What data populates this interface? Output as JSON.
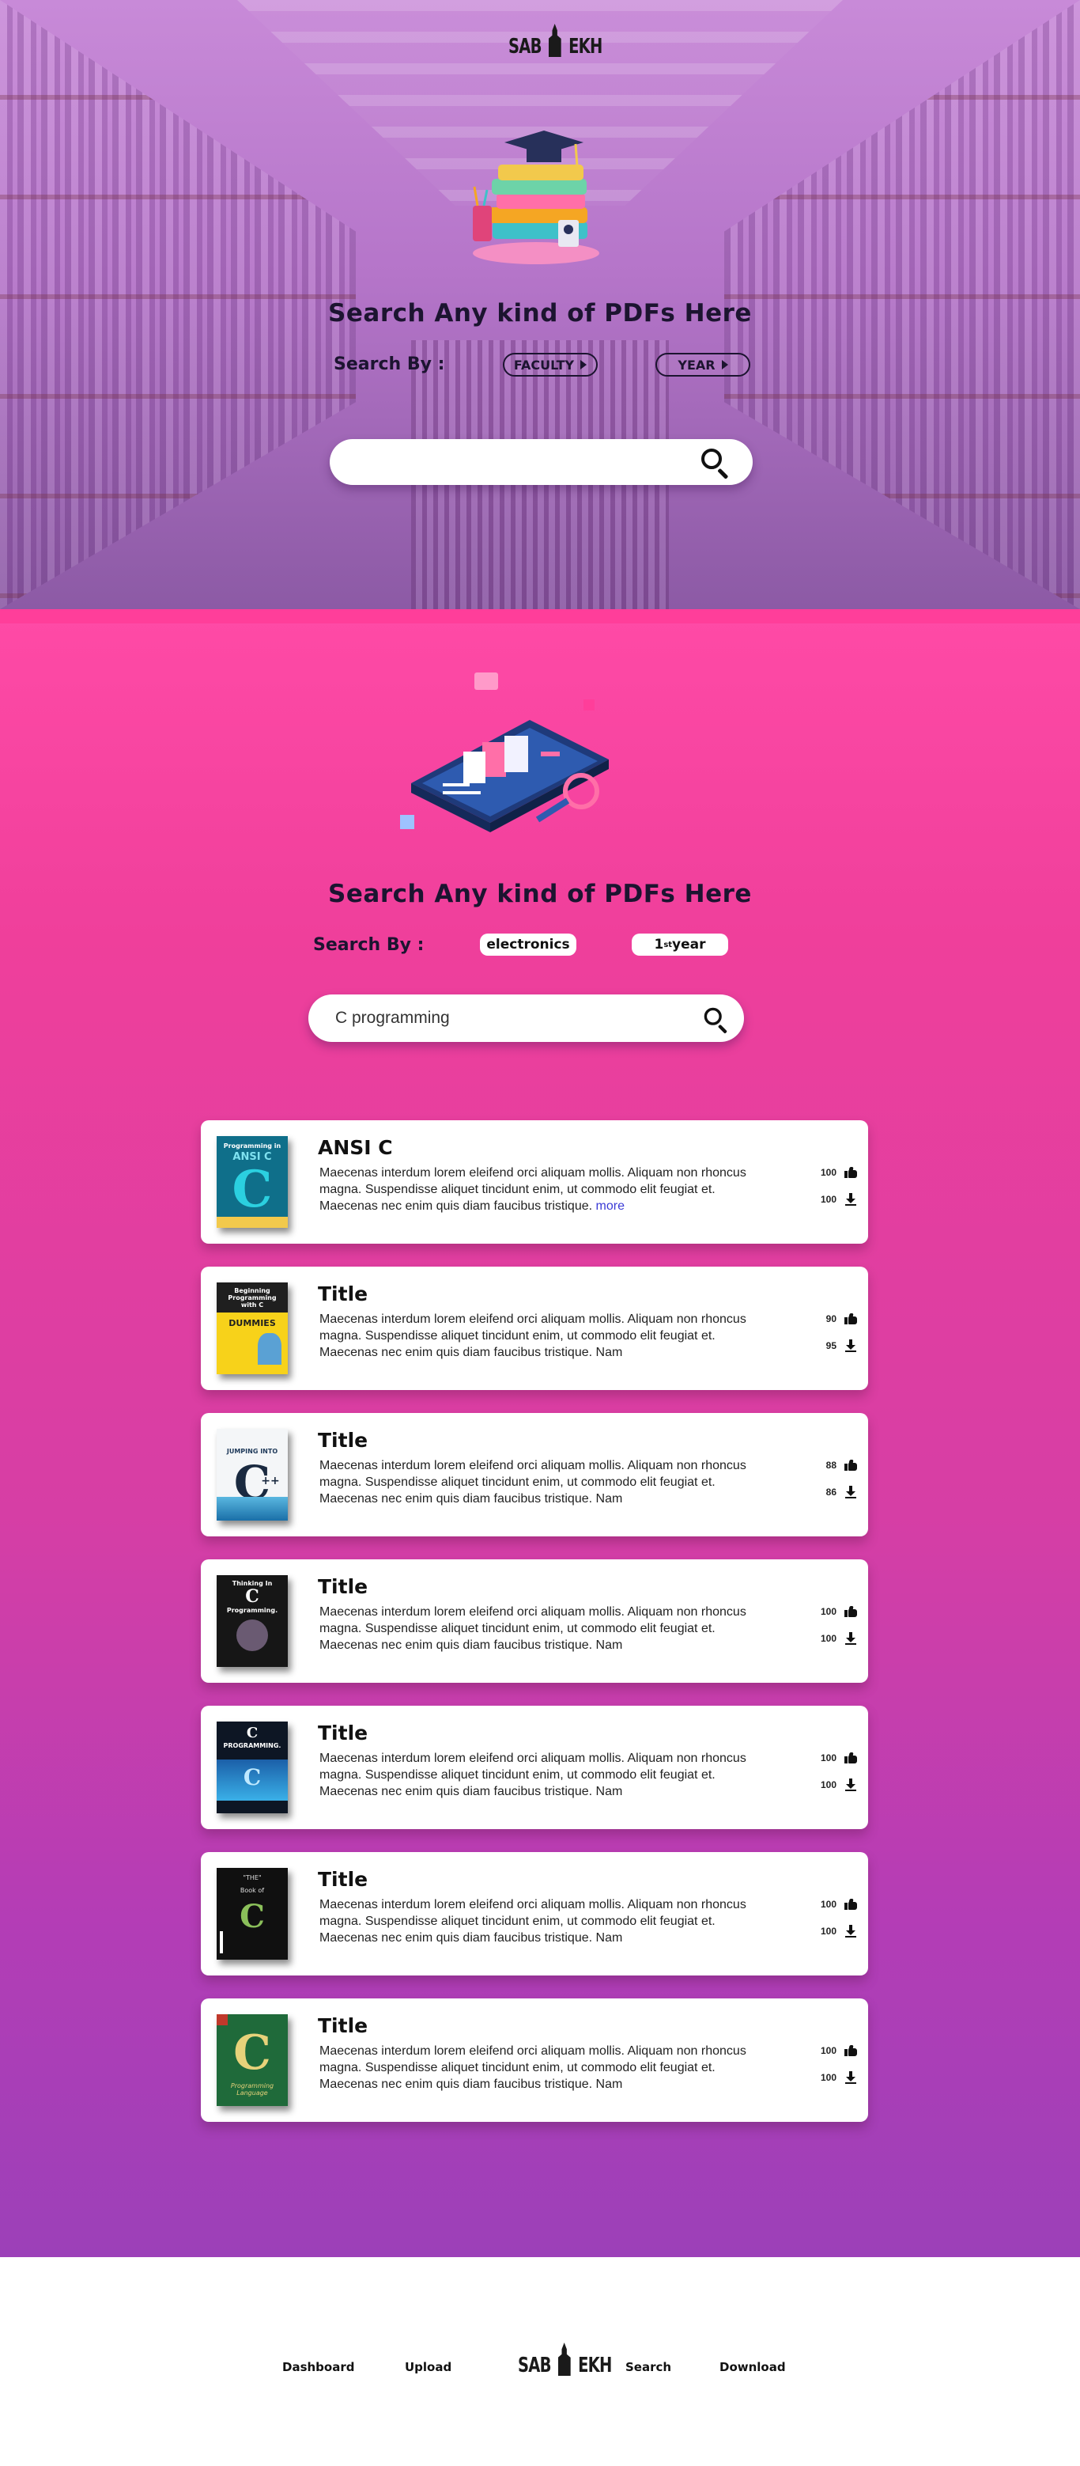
{
  "brand": {
    "logo_left": "SAB",
    "logo_right": "EKH"
  },
  "hero": {
    "title": "Search Any kind of  PDFs  Here",
    "search_by_label": "Search By :",
    "filters": [
      {
        "label": "FACULTY"
      },
      {
        "label": "YEAR"
      }
    ],
    "search": {
      "value": ""
    }
  },
  "main": {
    "title": "Search Any kind of  PDFs  Here",
    "search_by_label": "Search By :",
    "filter_faculty": "electronics",
    "filter_year_num": "1",
    "filter_year_sup": "st",
    "filter_year_word": "year",
    "search": {
      "value": "C programming"
    }
  },
  "results": [
    {
      "title": "ANSI C",
      "description": "Maecenas interdum lorem eleifend orci aliquam mollis. Aliquam non rhoncus magna. Suspendisse aliquet tincidunt enim, ut commodo elit feugiat et. Maecenas nec enim quis diam faucibus tristique.",
      "more": "more",
      "likes": "100",
      "downloads": "100",
      "cover": "Programming in ANSI C"
    },
    {
      "title": "Title",
      "description": "Maecenas interdum lorem eleifend orci aliquam mollis. Aliquam non rhoncus magna. Suspendisse aliquet tincidunt enim, ut commodo elit feugiat et. Maecenas nec enim quis diam faucibus tristique. Nam",
      "likes": "90",
      "downloads": "95",
      "cover": "Beginning Programming with C For Dummies"
    },
    {
      "title": "Title",
      "description": "Maecenas interdum lorem eleifend orci aliquam mollis. Aliquam non rhoncus magna. Suspendisse aliquet tincidunt enim, ut commodo elit feugiat et. Maecenas nec enim quis diam faucibus tristique. Nam",
      "likes": "88",
      "downloads": "86",
      "cover": "Jumping into C++"
    },
    {
      "title": "Title",
      "description": "Maecenas interdum lorem eleifend orci aliquam mollis. Aliquam non rhoncus magna. Suspendisse aliquet tincidunt enim, ut commodo elit feugiat et. Maecenas nec enim quis diam faucibus tristique. Nam",
      "likes": "100",
      "downloads": "100",
      "cover": "Thinking In C Programming"
    },
    {
      "title": "Title",
      "description": "Maecenas interdum lorem eleifend orci aliquam mollis. Aliquam non rhoncus magna. Suspendisse aliquet tincidunt enim, ut commodo elit feugiat et. Maecenas nec enim quis diam faucibus tristique. Nam",
      "likes": "100",
      "downloads": "100",
      "cover": "C Programming"
    },
    {
      "title": "Title",
      "description": "Maecenas interdum lorem eleifend orci aliquam mollis. Aliquam non rhoncus magna. Suspendisse aliquet tincidunt enim, ut commodo elit feugiat et. Maecenas nec enim quis diam faucibus tristique. Nam",
      "likes": "100",
      "downloads": "100",
      "cover": "THE Book of C"
    },
    {
      "title": "Title",
      "description": "Maecenas interdum lorem eleifend orci aliquam mollis. Aliquam non rhoncus magna. Suspendisse aliquet tincidunt enim, ut commodo elit feugiat et. Maecenas nec enim quis diam faucibus tristique. Nam",
      "likes": "100",
      "downloads": "100",
      "cover": "C Programming Language"
    }
  ],
  "footer": {
    "links": [
      "Dashboard",
      "Upload",
      "Search",
      "Download"
    ]
  },
  "colors": {
    "accent": "#ff4aa6",
    "purple": "#9c40b8",
    "more_link": "#3b3bd6"
  },
  "icons": [
    "search-icon",
    "like-icon",
    "download-icon",
    "chevron-right-icon"
  ]
}
